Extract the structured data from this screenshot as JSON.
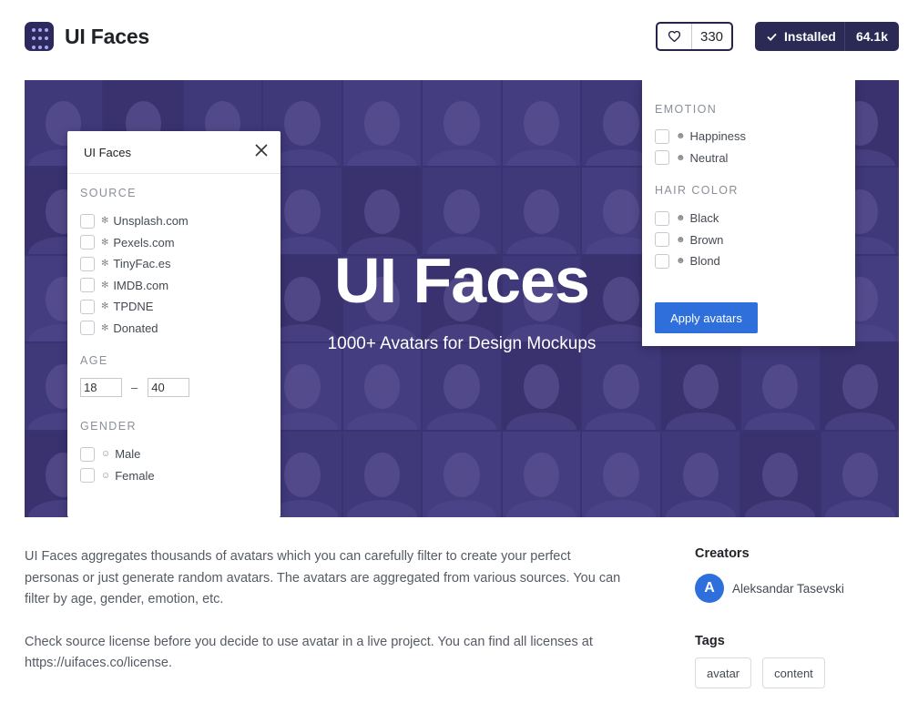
{
  "header": {
    "title": "UI Faces",
    "app_icon": "grid-dots-icon",
    "like": {
      "icon": "heart-icon",
      "count": "330"
    },
    "install": {
      "icon": "check-icon",
      "label": "Installed",
      "count": "64.1k"
    }
  },
  "banner": {
    "title": "UI Faces",
    "subtitle": "1000+ Avatars for Design Mockups",
    "left_panel": {
      "title": "UI Faces",
      "close_icon": "close-icon",
      "source_label": "SOURCE",
      "sources": [
        "Unsplash.com",
        "Pexels.com",
        "TinyFac.es",
        "IMDB.com",
        "TPDNE",
        "Donated"
      ],
      "age_label": "AGE",
      "age_min": "18",
      "age_max": "40",
      "age_separator": "–",
      "gender_label": "GENDER",
      "genders": [
        "Male",
        "Female"
      ]
    },
    "right_panel": {
      "emotion_label": "EMOTION",
      "emotions": [
        "Happiness",
        "Neutral"
      ],
      "hair_label": "HAIR COLOR",
      "hair_colors": [
        "Black",
        "Brown",
        "Blond"
      ],
      "apply_label": "Apply avatars"
    }
  },
  "description": {
    "para1": "UI Faces aggregates thousands of avatars which you can carefully filter to create your perfect personas or just generate random avatars. The avatars are aggregated from various sources. You can filter by age, gender, emotion, etc.",
    "para2_text": "Check source license before you decide to use avatar in a live project. You can find all licenses at ",
    "para2_link": "https://uifaces.co/license."
  },
  "sidebar": {
    "creators_label": "Creators",
    "creator": {
      "initial": "A",
      "name": "Aleksandar Tasevski"
    },
    "tags_label": "Tags",
    "tags": [
      "avatar",
      "content"
    ]
  },
  "colors": {
    "accent": "#2f6fdc",
    "dark": "#2b2a55",
    "banner": "#3b3573"
  }
}
